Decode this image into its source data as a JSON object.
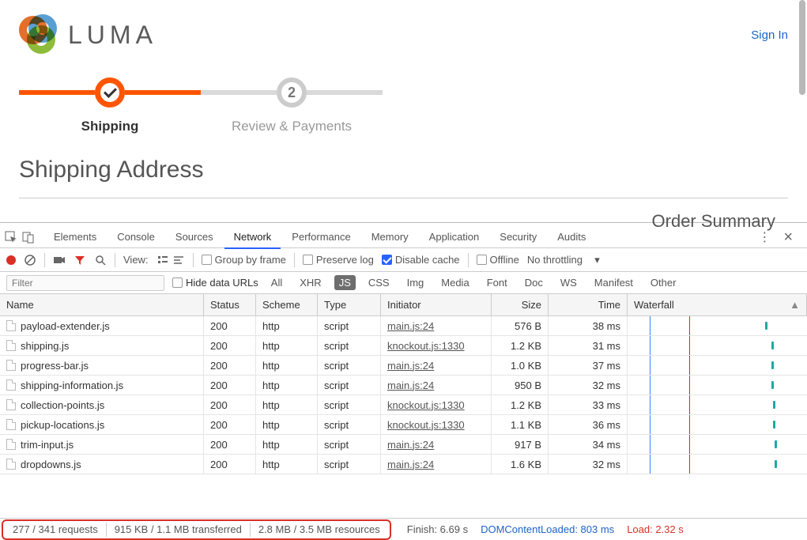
{
  "site": {
    "brand": "LUMA",
    "signin": "Sign In",
    "steps": {
      "shipping": "Shipping",
      "review": "Review & Payments",
      "review_num": "2"
    },
    "heading": "Shipping Address",
    "order_summary": "Order Summary"
  },
  "devtools": {
    "tabs": [
      "Elements",
      "Console",
      "Sources",
      "Network",
      "Performance",
      "Memory",
      "Application",
      "Security",
      "Audits"
    ],
    "active_tab": "Network",
    "toolbar": {
      "view_label": "View:",
      "group_by_frame": "Group by frame",
      "preserve_log": "Preserve log",
      "disable_cache": "Disable cache",
      "offline": "Offline",
      "throttling": "No throttling"
    },
    "filterbar": {
      "placeholder": "Filter",
      "hide_data_urls": "Hide data URLs",
      "types": [
        "All",
        "XHR",
        "JS",
        "CSS",
        "Img",
        "Media",
        "Font",
        "Doc",
        "WS",
        "Manifest",
        "Other"
      ],
      "active_type": "JS"
    },
    "columns": {
      "name": "Name",
      "status": "Status",
      "scheme": "Scheme",
      "type": "Type",
      "initiator": "Initiator",
      "size": "Size",
      "time": "Time",
      "waterfall": "Waterfall"
    },
    "rows": [
      {
        "name": "payload-extender.js",
        "status": "200",
        "scheme": "http",
        "type": "script",
        "initiator": "main.js:24",
        "size": "576 B",
        "time": "38 ms",
        "wf": 968
      },
      {
        "name": "shipping.js",
        "status": "200",
        "scheme": "http",
        "type": "script",
        "initiator": "knockout.js:1330",
        "size": "1.2 KB",
        "time": "31 ms",
        "wf": 976
      },
      {
        "name": "progress-bar.js",
        "status": "200",
        "scheme": "http",
        "type": "script",
        "initiator": "main.js:24",
        "size": "1.0 KB",
        "time": "37 ms",
        "wf": 976
      },
      {
        "name": "shipping-information.js",
        "status": "200",
        "scheme": "http",
        "type": "script",
        "initiator": "main.js:24",
        "size": "950 B",
        "time": "32 ms",
        "wf": 976
      },
      {
        "name": "collection-points.js",
        "status": "200",
        "scheme": "http",
        "type": "script",
        "initiator": "knockout.js:1330",
        "size": "1.2 KB",
        "time": "33 ms",
        "wf": 978
      },
      {
        "name": "pickup-locations.js",
        "status": "200",
        "scheme": "http",
        "type": "script",
        "initiator": "knockout.js:1330",
        "size": "1.1 KB",
        "time": "36 ms",
        "wf": 978
      },
      {
        "name": "trim-input.js",
        "status": "200",
        "scheme": "http",
        "type": "script",
        "initiator": "main.js:24",
        "size": "917 B",
        "time": "34 ms",
        "wf": 980
      },
      {
        "name": "dropdowns.js",
        "status": "200",
        "scheme": "http",
        "type": "script",
        "initiator": "main.js:24",
        "size": "1.6 KB",
        "time": "32 ms",
        "wf": 980
      }
    ],
    "waterfall_lines": {
      "blue": 822,
      "red": 872
    },
    "status": {
      "requests": "277 / 341 requests",
      "transferred": "915 KB / 1.1 MB transferred",
      "resources": "2.8 MB / 3.5 MB resources",
      "finish": "Finish: 6.69 s",
      "dcl": "DOMContentLoaded: 803 ms",
      "load": "Load: 2.32 s"
    }
  }
}
